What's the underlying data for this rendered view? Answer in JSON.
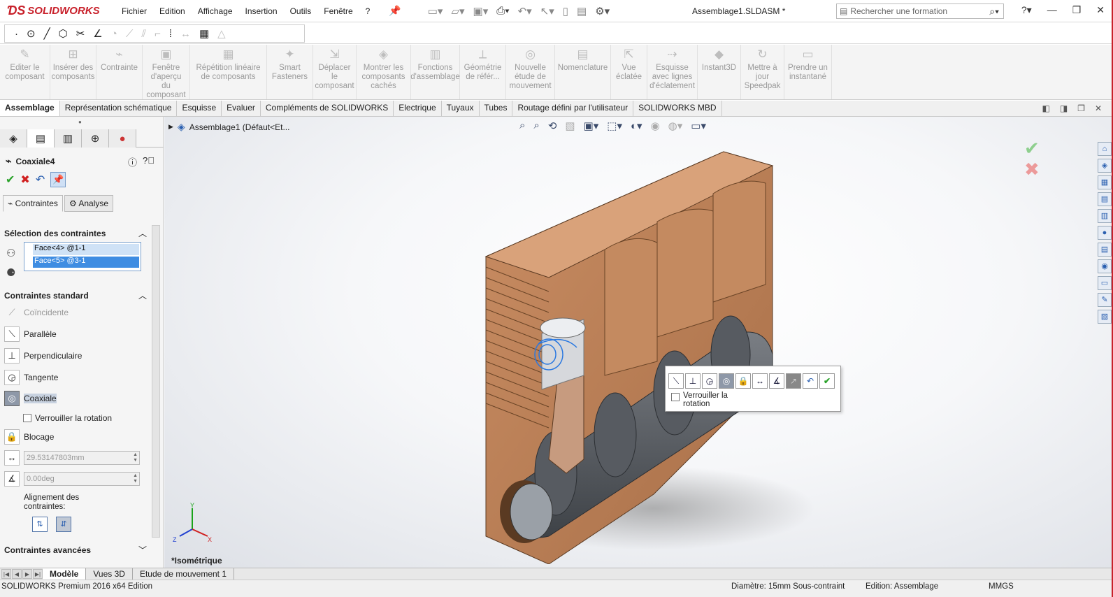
{
  "app": {
    "logo_text": "SOLIDWORKS",
    "document_title": "Assemblage1.SLDASM *"
  },
  "menu": [
    "Fichier",
    "Edition",
    "Affichage",
    "Insertion",
    "Outils",
    "Fenêtre",
    "?"
  ],
  "search": {
    "placeholder": "Rechercher une formation"
  },
  "commands": [
    {
      "label": "Editer le composant"
    },
    {
      "label": "Insérer des composants"
    },
    {
      "label": "Contrainte"
    },
    {
      "label": "Fenêtre d'aperçu du composant"
    },
    {
      "label": "Répétition linéaire de composants"
    },
    {
      "label": "Smart Fasteners"
    },
    {
      "label": "Déplacer le composant"
    },
    {
      "label": "Montrer les composants cachés"
    },
    {
      "label": "Fonctions d'assemblage"
    },
    {
      "label": "Géométrie de référ..."
    },
    {
      "label": "Nouvelle étude de mouvement"
    },
    {
      "label": "Nomenclature"
    },
    {
      "label": "Vue éclatée"
    },
    {
      "label": "Esquisse avec lignes d'éclatement"
    },
    {
      "label": "Instant3D"
    },
    {
      "label": "Mettre à jour Speedpak"
    },
    {
      "label": "Prendre un instantané"
    }
  ],
  "tabs": [
    "Assemblage",
    "Représentation schématique",
    "Esquisse",
    "Evaluer",
    "Compléments de SOLIDWORKS",
    "Electrique",
    "Tuyaux",
    "Tubes",
    "Routage défini par l'utilisateur",
    "SOLIDWORKS MBD"
  ],
  "panel": {
    "title": "Coaxiale4",
    "subtabs": [
      "Contraintes",
      "Analyse"
    ],
    "selection_header": "Sélection des contraintes",
    "selections": [
      "Face<4> @1-1",
      "Face<5> @3-1"
    ],
    "standard_header": "Contraintes standard",
    "mates": [
      "Coïncidente",
      "Parallèle",
      "Perpendiculaire",
      "Tangente",
      "Coaxiale"
    ],
    "lock_rotation": "Verrouiller la rotation",
    "lock": "Blocage",
    "distance_value": "29.53147803mm",
    "angle_value": "0.00deg",
    "alignment": "Alignement des contraintes:",
    "advanced_header": "Contraintes avancées"
  },
  "viewport": {
    "tree_root": "Assemblage1 (Défaut<Et...",
    "view_label": "*Isométrique",
    "context_lock_rotation": "Verrouiller la rotation",
    "triad": {
      "x": "X",
      "y": "Y",
      "z": "Z"
    }
  },
  "bottom_tabs": [
    "Modèle",
    "Vues 3D",
    "Etude de mouvement 1"
  ],
  "status": {
    "product": "SOLIDWORKS Premium 2016 x64 Edition",
    "info": "Diamètre: 15mm   Sous-contraint",
    "mode": "Edition: Assemblage",
    "units": "MMGS"
  },
  "colors": {
    "brand": "#c8202a",
    "model_body": "#c98d63",
    "crank": "#5a5e63",
    "selection": "#3f8de2"
  }
}
